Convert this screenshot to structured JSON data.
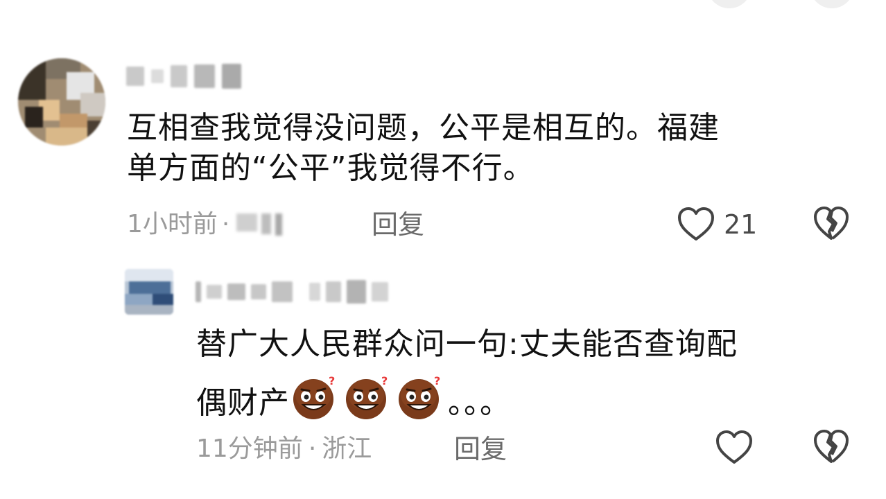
{
  "comment": {
    "text_line1": "互相查我觉得没问题，公平是相互的。福建",
    "text_line2": "单方面的“公平”我觉得不行。",
    "time": "1小时前",
    "dot": "·",
    "reply_label": "回复",
    "like_count": "21"
  },
  "sub_reply": {
    "text_line1": "替广大人民群众问一句:丈夫能否查询配",
    "text_line2_prefix": "偶财产",
    "text_line2_suffix": "。。。",
    "time": "11分钟前",
    "dot": "·",
    "location": "浙江",
    "reply_label": "回复"
  },
  "icons": {
    "like": "heart-outline-icon",
    "dislike": "broken-heart-icon",
    "emoji": "confused-face-emoji"
  },
  "colors": {
    "text": "#111111",
    "meta": "#9a9a9a",
    "reply": "#6a6a6a",
    "icon": "#444444",
    "emoji": "#7a3a1a"
  }
}
